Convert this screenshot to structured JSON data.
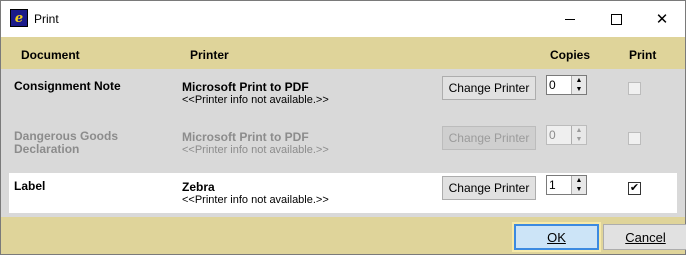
{
  "window": {
    "title": "Print",
    "app_icon": "logo-icon",
    "controls": {
      "minimize": "minimize-icon",
      "maximize": "maximize-icon",
      "close_glyph": "✕"
    }
  },
  "columns": {
    "document": "Document",
    "printer": "Printer",
    "copies": "Copies",
    "print": "Print"
  },
  "rows": [
    {
      "document": "Consignment Note",
      "printer": "Microsoft Print to PDF",
      "printer_info": "<<Printer info not available.>>",
      "button": "Change Printer",
      "copies": "0",
      "print_checked": false,
      "enabled": true
    },
    {
      "document": "Dangerous Goods Declaration",
      "printer": "Microsoft Print to PDF",
      "printer_info": "<<Printer info not available.>>",
      "button": "Change Printer",
      "copies": "0",
      "print_checked": false,
      "enabled": false
    },
    {
      "document": "Label",
      "printer": "Zebra",
      "printer_info": "<<Printer info not available.>>",
      "button": "Change Printer",
      "copies": "1",
      "print_checked": true,
      "enabled": true
    }
  ],
  "buttons": {
    "ok": "OK",
    "cancel": "Cancel"
  },
  "colors": {
    "header_bg": "#dfd49a",
    "grid_bg": "#d9d9d9",
    "selected_row_bg": "#ffffff",
    "ok_border": "#3c8ae0"
  }
}
